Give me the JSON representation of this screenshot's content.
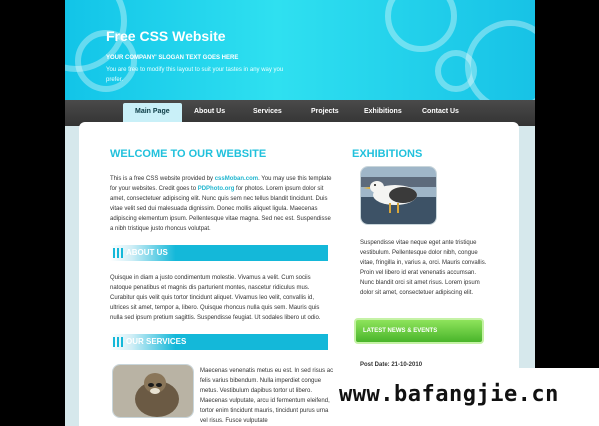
{
  "header": {
    "title": "Free CSS Website",
    "slogan": "YOUR COMPANY' SLOGAN TEXT GOES HERE",
    "subline": "You are free to modify this layout to suit your tastes in any way you prefer."
  },
  "nav": {
    "items": [
      "Main Page",
      "About Us",
      "Services",
      "Projects",
      "Exhibitions",
      "Contact Us"
    ]
  },
  "welcome": {
    "heading": "WELCOME TO OUR WEBSITE",
    "intro_1": "This is a free CSS website provided by ",
    "link_1": "cssMoban.com",
    "intro_2": ". You may use this template for your websites. Credit goes to ",
    "link_2": "PDPhoto.org",
    "intro_3": " for photos. Lorem ipsum dolor sit amet, consectetuer adipiscing elit. Nunc quis sem nec tellus blandit tincidunt. Duis vitae velit sed dui malesuada dignissim. Donec mollis aliquet ligula. Maecenas adipiscing elementum ipsum. Pellentesque vitae magna. Sed nec est. Suspendisse a nibh tristique justo rhoncus volutpat."
  },
  "about": {
    "heading": "ABOUT US",
    "text": "Quisque in diam a justo condimentum molestie. Vivamus a velit. Cum sociis natoque penatibus et magnis dis parturient montes, nascetur ridiculus mus. Curabitur quis velit quis tortor tincidunt aliquet. Vivamus leo velit, convallis id, ultrices sit amet, tempor a, libero. Quisque rhoncus nulla quis sem. Mauris quis nulla sed ipsum pretium sagittis. Suspendisse feugiat. Ut sodales libero ut odio."
  },
  "services": {
    "heading": "OUR SERVICES",
    "text": "Maecenas venenatis metus eu est. In sed risus ac felis varius bibendum. Nulla imperdiet congue metus. Vestibulum dapibus tortor ut libero. Maecenas vulputate, arcu id fermentum eleifend, tortor enim tincidunt mauris, tincidunt purus urna vel risus. Fusce vulputate"
  },
  "exhibitions": {
    "heading": "EXHIBITIONS",
    "text": "Suspendisse vitae neque eget ante tristique vestibulum. Pellentesque dolor nibh, congue vitae, fringilla in, varius a, orci. Mauris convallis. Proin vel libero id erat venenatis accumsan. Nunc blandit orci sit amet risus. Lorem ipsum dolor sit amet, consectetuer adipiscing elit."
  },
  "news": {
    "button_label": "LATEST NEWS & EVENTS",
    "post_date": "Post Date: 21-10-2010"
  },
  "watermark": {
    "text": "www.bafangjie.cn"
  },
  "colors": {
    "accent": "#21c1dc",
    "header_bg": "#18c8e8",
    "nav_bg": "#3c3c3c",
    "news_green": "#5cc236"
  }
}
